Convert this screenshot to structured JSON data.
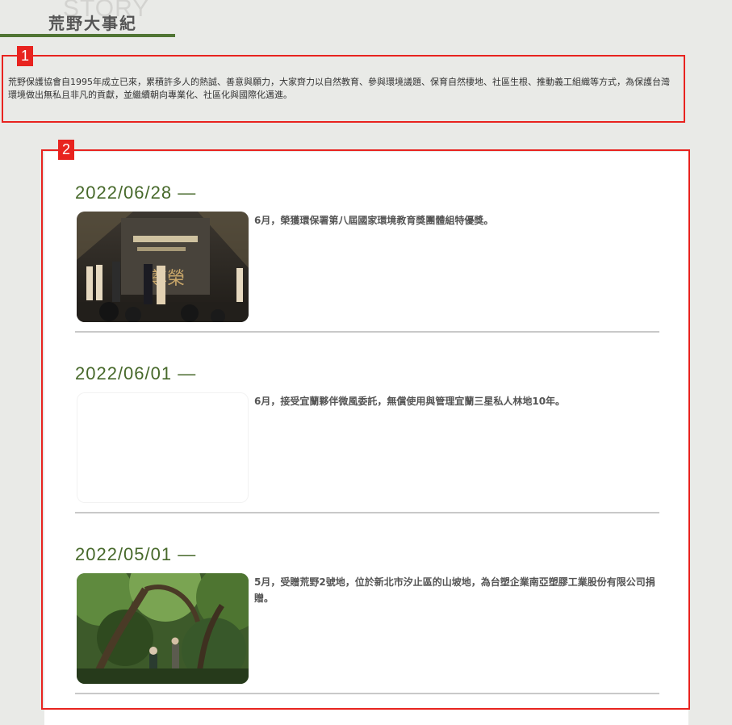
{
  "header": {
    "ghost_text": "STORY",
    "title": "荒野大事紀"
  },
  "annotations": [
    "1",
    "2"
  ],
  "intro": "荒野保護協會自1995年成立已來，累積許多人的熱誠、善意與願力，大家齊力以自然教育、參與環境議題、保育自然棲地、社區生根、推動義工組織等方式，為保護台灣環境做出無私且非凡的貢獻，並繼續朝向專業化、社區化與國際化邁進。",
  "entries": [
    {
      "date": "2022/06/28",
      "dash": "—",
      "description": "6月，榮獲環保署第八屆國家環境教育獎團體組特優獎。",
      "image": "award-ceremony-photo"
    },
    {
      "date": "2022/06/01",
      "dash": "—",
      "description": "6月，接受宜蘭夥伴微風委託，無償使用與管理宜蘭三星私人林地10年。",
      "image": "blank-photo"
    },
    {
      "date": "2022/05/01",
      "dash": "—",
      "description": "5月，受贈荒野2號地，位於新北市汐止區的山坡地，為台塑企業南亞塑膠工業股份有限公司捐贈。",
      "image": "forest-hike-photo"
    }
  ],
  "colors": {
    "accent": "#47692b",
    "annotation": "#e8231f",
    "background": "#e9eae7"
  }
}
